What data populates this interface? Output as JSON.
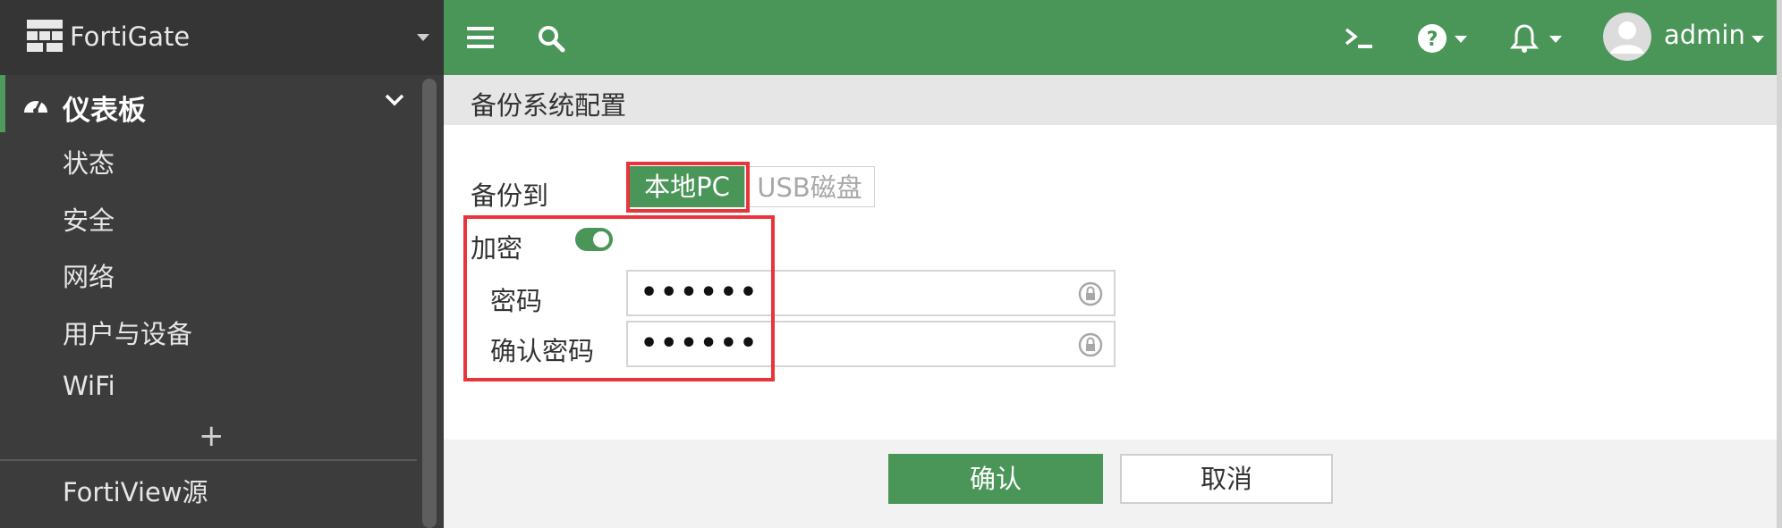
{
  "brand": {
    "name": "FortiGate"
  },
  "sidebar": {
    "section": "仪表板",
    "items": [
      "状态",
      "安全",
      "网络",
      "用户与设备",
      "WiFi"
    ],
    "add_label": "+",
    "bottom_item": "FortiView源"
  },
  "topbar": {
    "icons": [
      "menu-icon",
      "search-icon",
      "cli-console-icon",
      "help-icon",
      "notification-bell-icon",
      "user-avatar"
    ],
    "user": "admin"
  },
  "page": {
    "title": "备份系统配置",
    "backup_to_label": "备份到",
    "backup_options": [
      "本地PC",
      "USB磁盘"
    ],
    "selected_option": "本地PC",
    "encrypt_label": "加密",
    "encrypt_enabled": true,
    "password_label": "密码",
    "password_value": "••••••",
    "confirm_label": "确认密码",
    "confirm_value": "••••••"
  },
  "actions": {
    "ok": "确认",
    "cancel": "取消"
  },
  "colors": {
    "accent": "#4a9558",
    "sidebar_bg": "#3c3c3c",
    "highlight": "#e8343a"
  }
}
